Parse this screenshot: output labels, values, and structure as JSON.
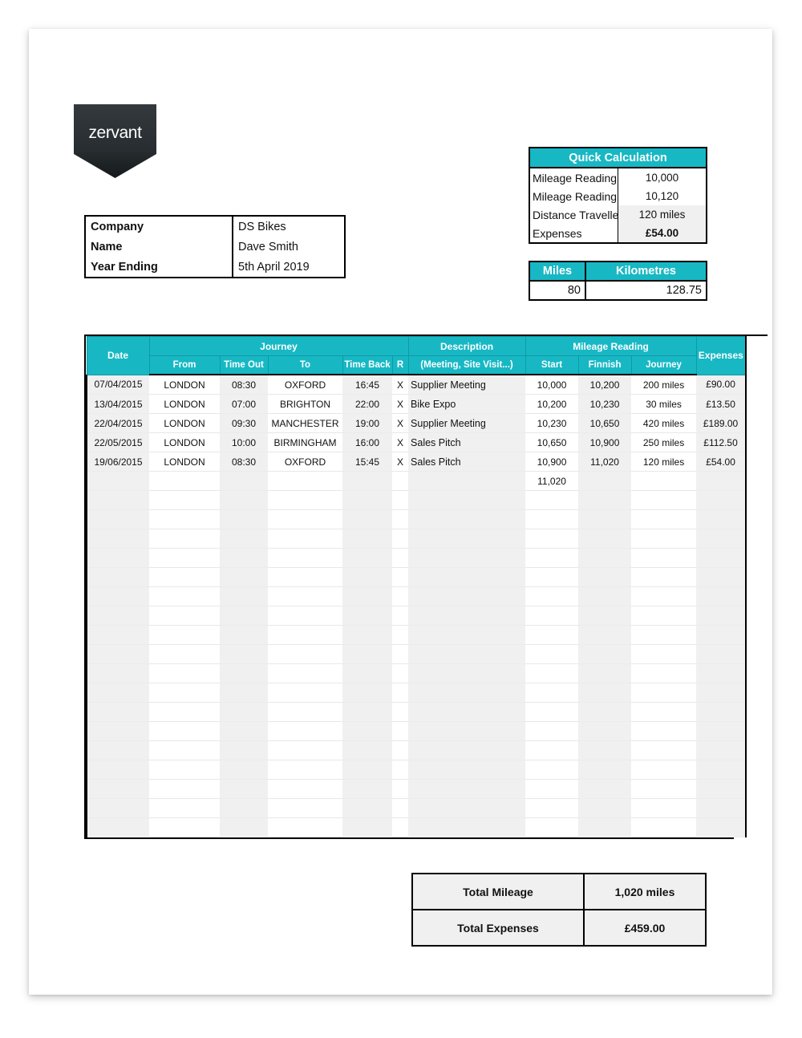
{
  "brand": {
    "logo_text": "zervant",
    "accent_color": "#17b8c4"
  },
  "info": {
    "rows": [
      {
        "label": "Company",
        "value": "DS Bikes"
      },
      {
        "label": "Name",
        "value": "Dave Smith"
      },
      {
        "label": "Year Ending",
        "value": "5th April 2019"
      }
    ]
  },
  "quick_calculation": {
    "title": "Quick Calculation",
    "rows": [
      {
        "label": "Mileage Reading - S",
        "value": "10,000"
      },
      {
        "label": "Mileage Reading - E",
        "value": "10,120"
      },
      {
        "label": "Distance Travelled",
        "value": "120 miles"
      },
      {
        "label": "Expenses",
        "value": "£54.00"
      }
    ]
  },
  "converter": {
    "headers": {
      "miles": "Miles",
      "kilometres": "Kilometres"
    },
    "values": {
      "miles": "80",
      "kilometres": "128.75"
    }
  },
  "ledger": {
    "group_headers": {
      "date": "Date",
      "journey": "Journey",
      "description": "Description",
      "mileage_reading": "Mileage Reading",
      "expenses": "Expenses"
    },
    "sub_headers": {
      "from": "From",
      "time_out": "Time Out",
      "to": "To",
      "time_back": "Time Back",
      "r": "R",
      "description_hint": "(Meeting, Site Visit...)",
      "start": "Start",
      "finnish": "Finnish",
      "journey": "Journey"
    },
    "rows": [
      {
        "date": "07/04/2015",
        "from": "LONDON",
        "time_out": "08:30",
        "to": "OXFORD",
        "time_back": "16:45",
        "r": "X",
        "description": "Supplier Meeting",
        "start": "10,000",
        "finnish": "10,200",
        "journey": "200 miles",
        "expenses": "£90.00"
      },
      {
        "date": "13/04/2015",
        "from": "LONDON",
        "time_out": "07:00",
        "to": "BRIGHTON",
        "time_back": "22:00",
        "r": "X",
        "description": "Bike Expo",
        "start": "10,200",
        "finnish": "10,230",
        "journey": "30 miles",
        "expenses": "£13.50"
      },
      {
        "date": "22/04/2015",
        "from": "LONDON",
        "time_out": "09:30",
        "to": "MANCHESTER",
        "time_back": "19:00",
        "r": "X",
        "description": "Supplier Meeting",
        "start": "10,230",
        "finnish": "10,650",
        "journey": "420 miles",
        "expenses": "£189.00"
      },
      {
        "date": "22/05/2015",
        "from": "LONDON",
        "time_out": "10:00",
        "to": "BIRMINGHAM",
        "time_back": "16:00",
        "r": "X",
        "description": "Sales Pitch",
        "start": "10,650",
        "finnish": "10,900",
        "journey": "250 miles",
        "expenses": "£112.50"
      },
      {
        "date": "19/06/2015",
        "from": "LONDON",
        "time_out": "08:30",
        "to": "OXFORD",
        "time_back": "15:45",
        "r": "X",
        "description": "Sales Pitch",
        "start": "10,900",
        "finnish": "11,020",
        "journey": "120 miles",
        "expenses": "£54.00"
      },
      {
        "date": "",
        "from": "",
        "time_out": "",
        "to": "",
        "time_back": "",
        "r": "",
        "description": "",
        "start": "11,020",
        "finnish": "",
        "journey": "",
        "expenses": ""
      }
    ],
    "empty_row_count": 18
  },
  "totals": {
    "rows": [
      {
        "label": "Total Mileage",
        "value": "1,020 miles"
      },
      {
        "label": "Total Expenses",
        "value": "£459.00"
      }
    ]
  }
}
